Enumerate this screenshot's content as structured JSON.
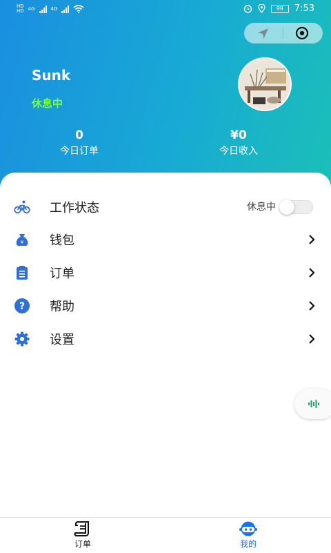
{
  "status_bar": {
    "time": "7:53",
    "battery": "99",
    "network_labels": [
      "4G",
      "4G"
    ],
    "sim_labels": [
      "HD",
      "HD"
    ]
  },
  "profile": {
    "name": "Sunk",
    "status": "休息中"
  },
  "stats": {
    "orders_value": "0",
    "orders_label": "今日订单",
    "income_value": "¥0",
    "income_label": "今日收入"
  },
  "menu": {
    "work_status": {
      "label": "工作状态",
      "toggle_text": "休息中",
      "toggle_on": false,
      "icon": "bicycle-icon"
    },
    "wallet": {
      "label": "钱包",
      "icon": "money-bag-icon"
    },
    "orders": {
      "label": "订单",
      "icon": "clipboard-icon"
    },
    "help": {
      "label": "帮助",
      "icon": "question-icon"
    },
    "settings": {
      "label": "设置",
      "icon": "gear-icon"
    }
  },
  "tabbar": {
    "orders_label": "订单",
    "mine_label": "我的",
    "active_tab": "mine"
  },
  "colors": {
    "header_start": "#1a8fe0",
    "header_end": "#1bbfb8",
    "status_green": "#7cff3c",
    "icon_blue": "#2f6fd6",
    "tab_active": "#1a73e8"
  }
}
